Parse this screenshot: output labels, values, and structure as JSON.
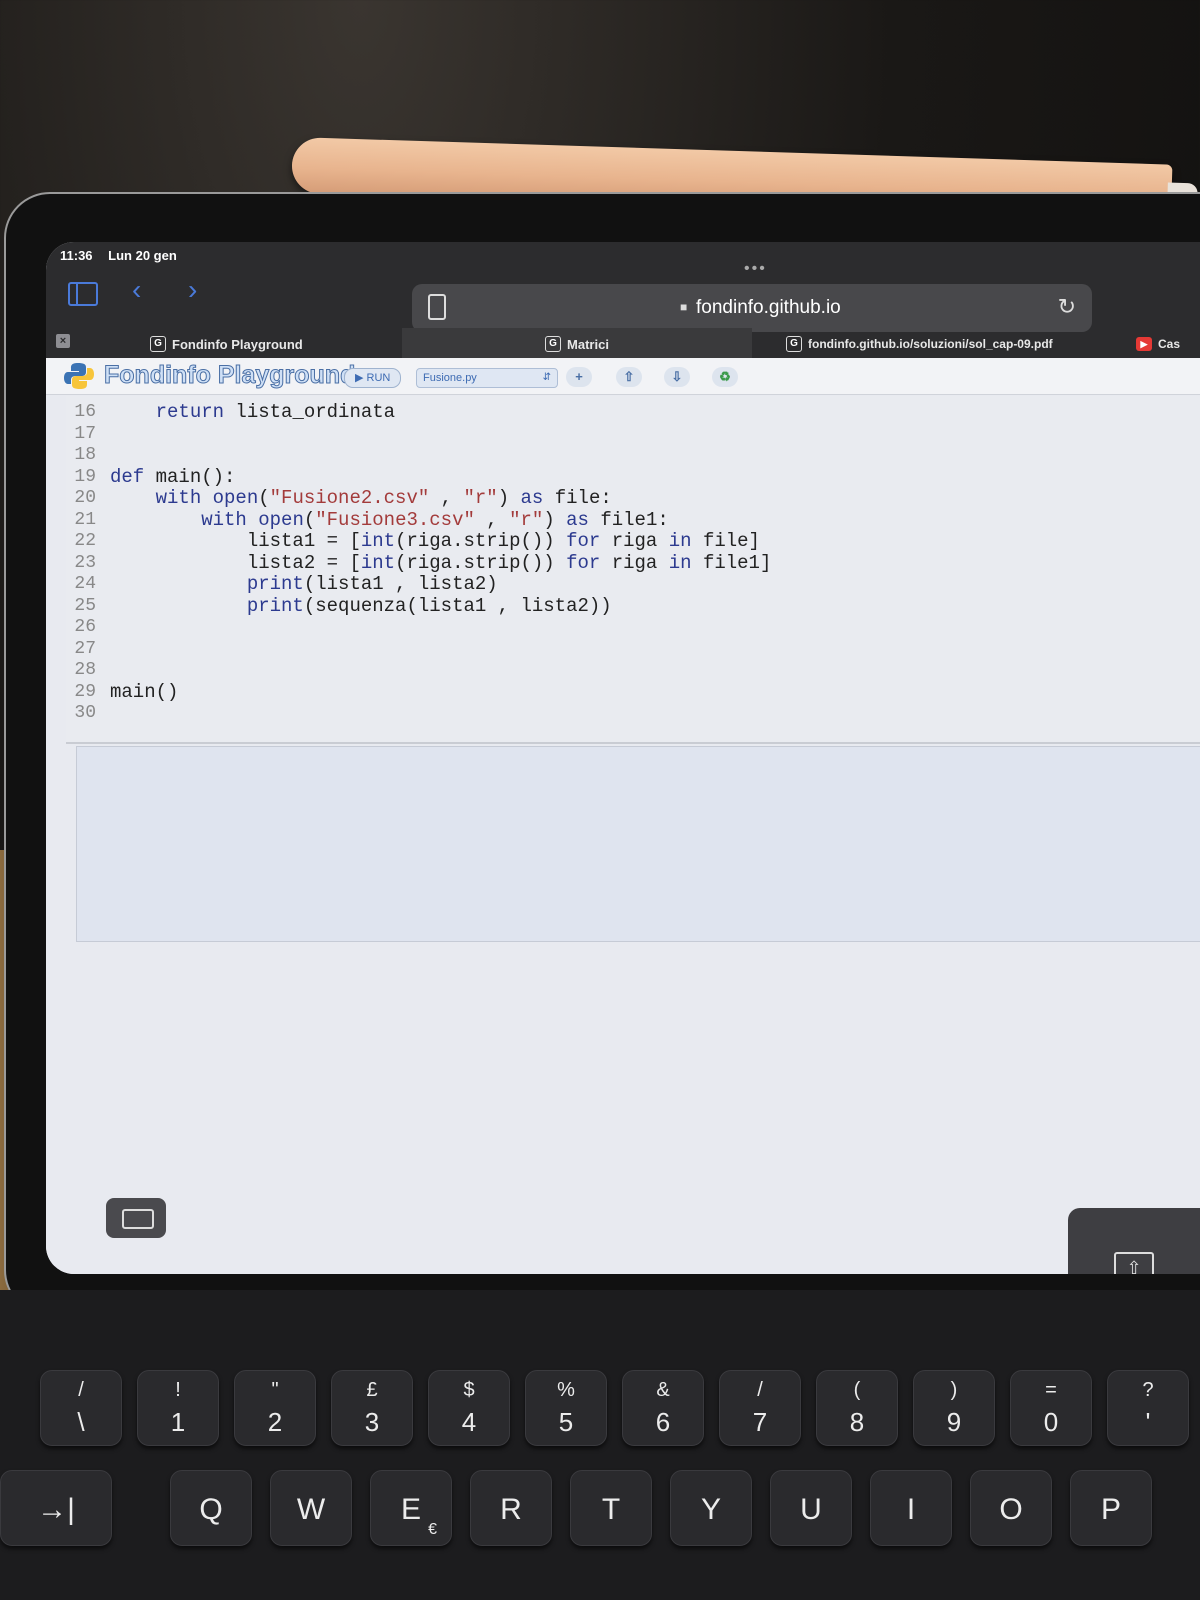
{
  "status_bar": {
    "time": "11:36",
    "date": "Lun 20 gen"
  },
  "browser": {
    "url": "fondinfo.github.io",
    "tabs": [
      {
        "label": "Fondinfo Playground",
        "active": false
      },
      {
        "label": "Matrici",
        "active": true
      },
      {
        "label": "fondinfo.github.io/soluzioni/sol_cap-09.pdf",
        "active": false
      },
      {
        "label": "Cas",
        "active": false
      }
    ]
  },
  "playground": {
    "title": "Fondinfo Playground",
    "run_label": "RUN",
    "file_selected": "Fusione.py",
    "add_label": "+"
  },
  "editor": {
    "line_numbers": [
      "16",
      "17",
      "18",
      "19",
      "20",
      "21",
      "22",
      "23",
      "24",
      "25",
      "26",
      "27",
      "28",
      "29",
      "30"
    ],
    "lines": [
      "    return lista_ordinata",
      "",
      "",
      "def main():",
      "    with open(\"Fusione2.csv\" , \"r\") as file:",
      "        with open(\"Fusione3.csv\" , \"r\") as file1:",
      "            lista1 = [int(riga.strip()) for riga in file]",
      "            lista2 = [int(riga.strip()) for riga in file1]",
      "            print(lista1 , lista2)",
      "            print(sequenza(lista1 , lista2))",
      "",
      "",
      "",
      "main()",
      ""
    ]
  },
  "keyboard": {
    "row1": [
      {
        "top": "/",
        "bottom": "\\"
      },
      {
        "top": "!",
        "bottom": "1"
      },
      {
        "top": "\"",
        "bottom": "2"
      },
      {
        "top": "£",
        "bottom": "3"
      },
      {
        "top": "$",
        "bottom": "4"
      },
      {
        "top": "%",
        "bottom": "5"
      },
      {
        "top": "&",
        "bottom": "6"
      },
      {
        "top": "/",
        "bottom": "7"
      },
      {
        "top": "(",
        "bottom": "8"
      },
      {
        "top": ")",
        "bottom": "9"
      },
      {
        "top": "=",
        "bottom": "0"
      },
      {
        "top": "?",
        "bottom": "'"
      }
    ],
    "row2": [
      {
        "main": "→|"
      },
      {
        "main": "Q"
      },
      {
        "main": "W"
      },
      {
        "main": "E",
        "alt": "€"
      },
      {
        "main": "R"
      },
      {
        "main": "T"
      },
      {
        "main": "Y"
      },
      {
        "main": "U"
      },
      {
        "main": "I"
      },
      {
        "main": "O"
      },
      {
        "main": "P"
      }
    ]
  },
  "icons": {
    "sidebar": "sidebar-icon",
    "back": "chevron-left-icon",
    "forward": "chevron-right-icon",
    "reload": "reload-icon",
    "lock": "lock-icon",
    "tabs": "tabs-icon",
    "upload": "upload-icon",
    "download": "download-icon",
    "recycle": "recycle-icon",
    "keyboard": "keyboard-icon",
    "share": "share-up-icon"
  },
  "colors": {
    "accent": "#4a7ad9",
    "keyword": "#2c3a8f",
    "string": "#a33b3b",
    "youtube": "#e53935"
  }
}
